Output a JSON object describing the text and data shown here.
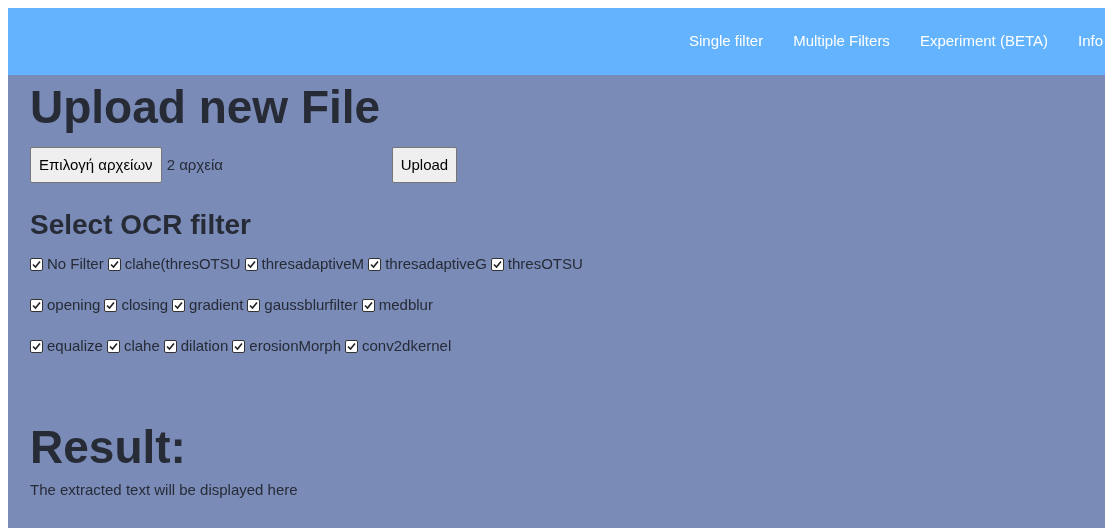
{
  "nav": [
    {
      "label": "Single filter"
    },
    {
      "label": "Multiple Filters"
    },
    {
      "label": "Experiment (BETA)"
    },
    {
      "label": "Info"
    }
  ],
  "upload": {
    "title": "Upload new File",
    "choose_button": "Επιλογή αρχείων",
    "file_status": "2 αρχεία",
    "upload_button": "Upload"
  },
  "filters": {
    "title": "Select OCR filter",
    "options": [
      {
        "label": "No Filter",
        "checked": true
      },
      {
        "label": "clahe(thresOTSU",
        "checked": true
      },
      {
        "label": "thresadaptiveM",
        "checked": true
      },
      {
        "label": "thresadaptiveG",
        "checked": true
      },
      {
        "label": "thresOTSU",
        "checked": true
      },
      {
        "label": "opening",
        "checked": true
      },
      {
        "label": "closing",
        "checked": true
      },
      {
        "label": "gradient",
        "checked": true
      },
      {
        "label": "gaussblurfilter",
        "checked": true
      },
      {
        "label": "medblur",
        "checked": true
      },
      {
        "label": "equalize",
        "checked": true
      },
      {
        "label": "clahe",
        "checked": true
      },
      {
        "label": "dilation",
        "checked": true
      },
      {
        "label": "erosionMorph",
        "checked": true
      },
      {
        "label": "conv2dkernel",
        "checked": true
      }
    ]
  },
  "result": {
    "title": "Result:",
    "text": "The extracted text will be displayed here"
  }
}
